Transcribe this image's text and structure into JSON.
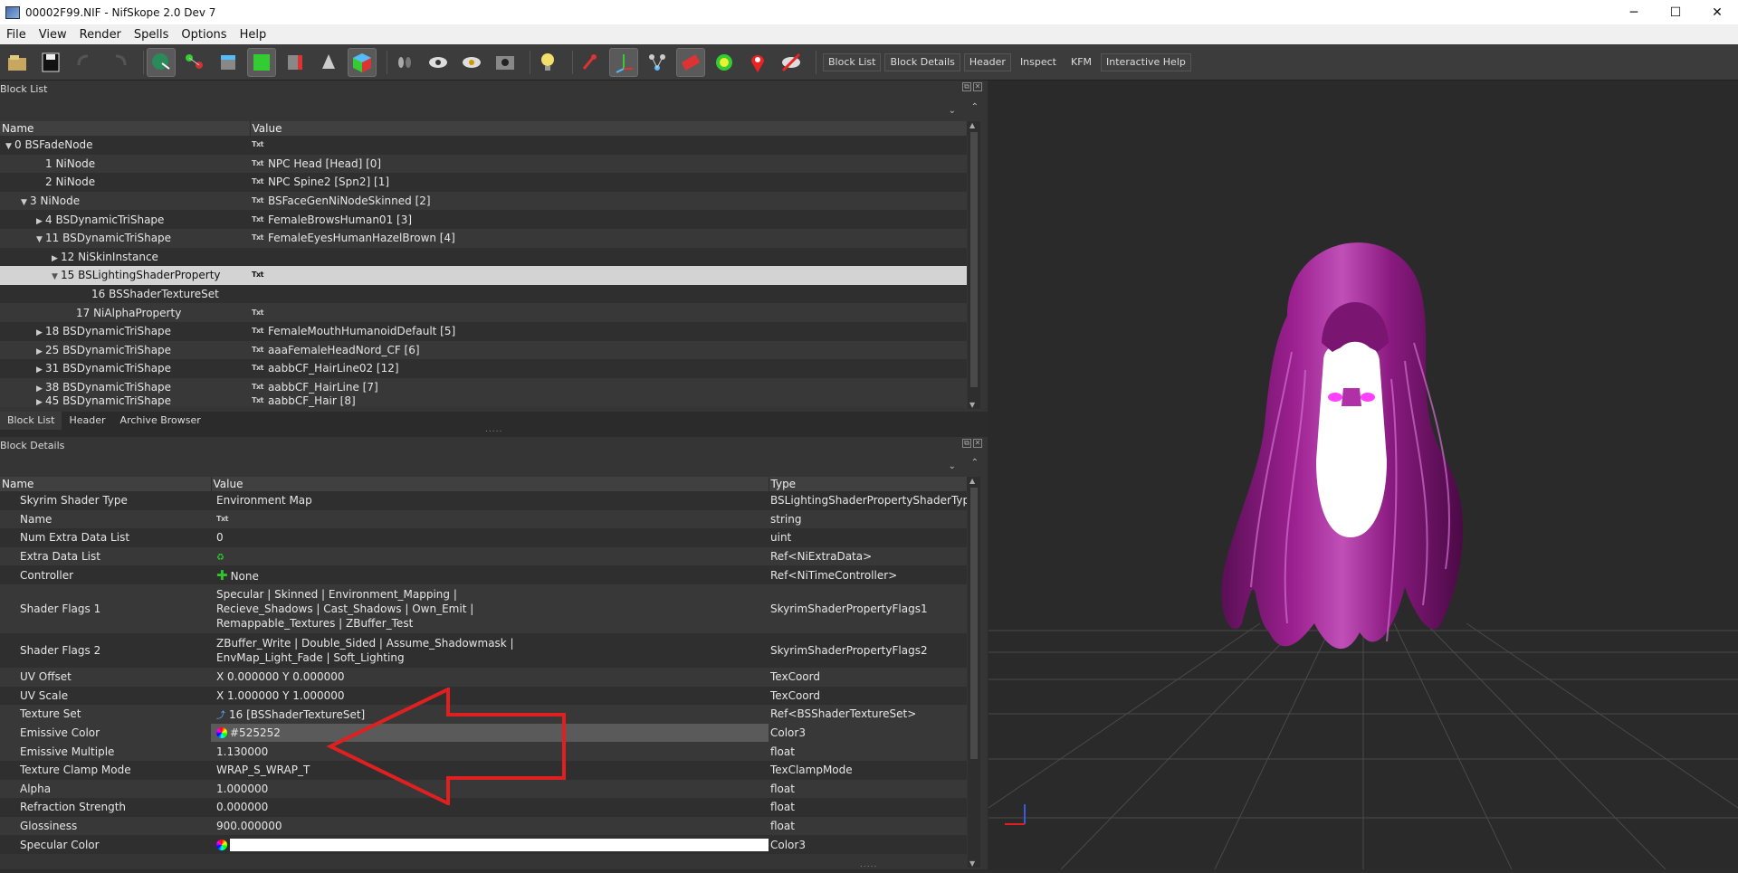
{
  "window": {
    "title": "00002F99.NIF - NifSkope 2.0 Dev 7",
    "minimize": "─",
    "maximize": "☐",
    "close": "✕"
  },
  "menu": [
    "File",
    "View",
    "Render",
    "Spells",
    "Options",
    "Help"
  ],
  "toolbar": {
    "text_buttons": [
      "Block List",
      "Block Details",
      "Header",
      "Inspect",
      "KFM",
      "Interactive Help"
    ]
  },
  "block_list": {
    "title": "Block List",
    "columns": {
      "name": "Name",
      "value": "Value"
    },
    "rows": [
      {
        "name": "0 BSFadeNode",
        "value": "",
        "arrow": "▼",
        "indent": 0,
        "txt": true
      },
      {
        "name": "1 NiNode",
        "value": "NPC Head [Head] [0]",
        "arrow": "",
        "indent": 2,
        "txt": true
      },
      {
        "name": "2 NiNode",
        "value": "NPC Spine2 [Spn2] [1]",
        "arrow": "",
        "indent": 2,
        "txt": true
      },
      {
        "name": "3 NiNode",
        "value": "BSFaceGenNiNodeSkinned [2]",
        "arrow": "▼",
        "indent": 1,
        "txt": true
      },
      {
        "name": "4 BSDynamicTriShape",
        "value": "FemaleBrowsHuman01 [3]",
        "arrow": "▶",
        "indent": 2,
        "txt": true
      },
      {
        "name": "11 BSDynamicTriShape",
        "value": "FemaleEyesHumanHazelBrown [4]",
        "arrow": "▼",
        "indent": 2,
        "txt": true
      },
      {
        "name": "12 NiSkinInstance",
        "value": "",
        "arrow": "▶",
        "indent": 3,
        "txt": false
      },
      {
        "name": "15 BSLightingShaderProperty",
        "value": "",
        "arrow": "▼",
        "indent": 3,
        "txt": true,
        "selected": true
      },
      {
        "name": "16 BSShaderTextureSet",
        "value": "",
        "arrow": "",
        "indent": 5,
        "txt": false
      },
      {
        "name": "17 NiAlphaProperty",
        "value": "",
        "arrow": "",
        "indent": 4,
        "txt": true
      },
      {
        "name": "18 BSDynamicTriShape",
        "value": "FemaleMouthHumanoidDefault [5]",
        "arrow": "▶",
        "indent": 2,
        "txt": true
      },
      {
        "name": "25 BSDynamicTriShape",
        "value": "aaaFemaleHeadNord_CF [6]",
        "arrow": "▶",
        "indent": 2,
        "txt": true
      },
      {
        "name": "31 BSDynamicTriShape",
        "value": "aabbCF_HairLine02 [12]",
        "arrow": "▶",
        "indent": 2,
        "txt": true
      },
      {
        "name": "38 BSDynamicTriShape",
        "value": "aabbCF_HairLine [7]",
        "arrow": "▶",
        "indent": 2,
        "txt": true
      }
    ],
    "partial_row": {
      "name": "45 BSDynamicTriShape",
      "value": "aabbCF_Hair [8]"
    },
    "txt_label": "Txt"
  },
  "tabs": [
    "Block List",
    "Header",
    "Archive Browser"
  ],
  "block_details": {
    "title": "Block Details",
    "columns": {
      "name": "Name",
      "value": "Value",
      "type": "Type"
    },
    "rows": [
      {
        "name": "Skyrim Shader Type",
        "value": "Environment Map",
        "type": "BSLightingShaderPropertyShaderType"
      },
      {
        "name": "Name",
        "value": "",
        "type": "string",
        "icon": "txt"
      },
      {
        "name": "Num Extra Data List",
        "value": "0",
        "type": "uint"
      },
      {
        "name": "Extra Data List",
        "value": "",
        "type": "Ref<NiExtraData>",
        "icon": "link"
      },
      {
        "name": "Controller",
        "value": "None",
        "type": "Ref<NiTimeController>",
        "icon": "plus"
      },
      {
        "name": "Shader Flags 1",
        "value": "Specular | Skinned | Environment_Mapping |\nRecieve_Shadows | Cast_Shadows | Own_Emit |\nRemappable_Textures | ZBuffer_Test",
        "type": "SkyrimShaderPropertyFlags1",
        "multi": 3
      },
      {
        "name": "Shader Flags 2",
        "value": "ZBuffer_Write | Double_Sided | Assume_Shadowmask |\nEnvMap_Light_Fade | Soft_Lighting",
        "type": "SkyrimShaderPropertyFlags2",
        "multi": 2
      },
      {
        "name": "UV Offset",
        "value": "X 0.000000 Y 0.000000",
        "type": "TexCoord"
      },
      {
        "name": "UV Scale",
        "value": "X 1.000000 Y 1.000000",
        "type": "TexCoord"
      },
      {
        "name": "Texture Set",
        "value": "16 [BSShaderTextureSet]",
        "type": "Ref<BSShaderTextureSet>",
        "icon": "tex"
      },
      {
        "name": "Emissive Color",
        "value": "#525252",
        "type": "Color3",
        "icon": "color",
        "highlight": true
      },
      {
        "name": "Emissive Multiple",
        "value": "1.130000",
        "type": "float"
      },
      {
        "name": "Texture Clamp Mode",
        "value": "WRAP_S_WRAP_T",
        "type": "TexClampMode"
      },
      {
        "name": "Alpha",
        "value": "1.000000",
        "type": "float"
      },
      {
        "name": "Refraction Strength",
        "value": "0.000000",
        "type": "float"
      },
      {
        "name": "Glossiness",
        "value": "900.000000",
        "type": "float"
      },
      {
        "name": "Specular Color",
        "value": "",
        "type": "Color3",
        "icon": "color",
        "whitebar": true
      }
    ]
  },
  "colors": {
    "hair": "#8a1a80",
    "hair_highlight": "#d070d0",
    "face": "#ffffff",
    "eyes": "#ff40ff",
    "arrow": "#e02020",
    "selection": "#d3d3d3"
  }
}
